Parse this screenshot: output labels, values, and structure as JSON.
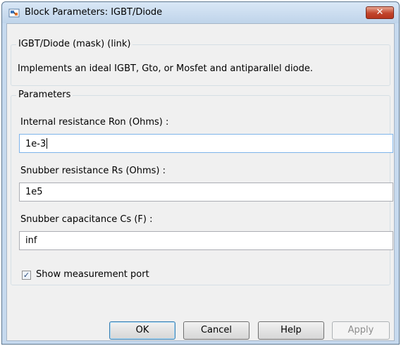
{
  "window": {
    "title": "Block Parameters: IGBT/Diode",
    "close_label": "✕"
  },
  "mask_group": {
    "legend": "IGBT/Diode (mask) (link)",
    "description": "Implements an ideal  IGBT, Gto, or Mosfet and antiparallel diode."
  },
  "parameters": {
    "legend": "Parameters",
    "fields": [
      {
        "label": "Internal resistance Ron (Ohms) :",
        "value": "1e-3"
      },
      {
        "label": "Snubber resistance Rs (Ohms) :",
        "value": "1e5"
      },
      {
        "label": "Snubber capacitance Cs (F) :",
        "value": "inf"
      }
    ],
    "show_measurement": {
      "label": "Show measurement port",
      "checked": true,
      "mark": "✓"
    }
  },
  "buttons": {
    "ok": "OK",
    "cancel": "Cancel",
    "help": "Help",
    "apply": "Apply"
  },
  "colors": {
    "close_button": "#c2452b",
    "title_bar": "#c6d9ee",
    "focus_border": "#7eb4ea"
  }
}
